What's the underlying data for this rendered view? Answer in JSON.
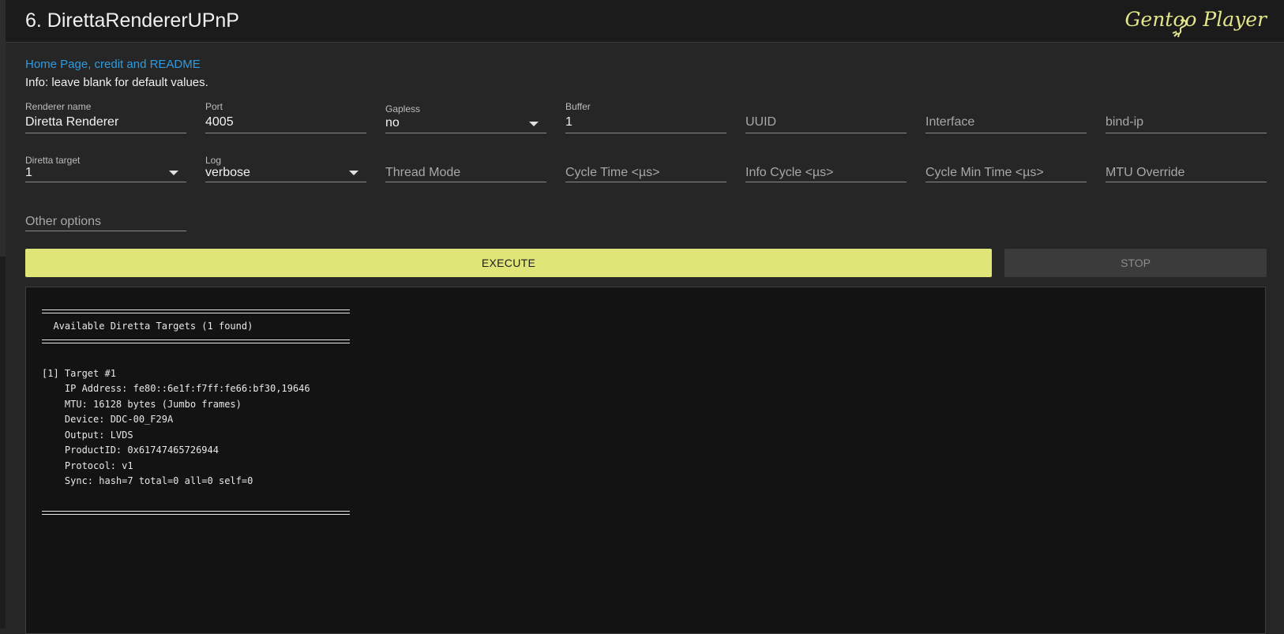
{
  "header": {
    "title": "6. DirettaRendererUPnP",
    "logo_text": "Gentoo Player"
  },
  "intro": {
    "link_text": "Home Page, credit and README",
    "info_text": "Info: leave blank for default values."
  },
  "fields": {
    "renderer_name": {
      "label": "Renderer name",
      "value": "Diretta Renderer"
    },
    "port": {
      "label": "Port",
      "value": "4005"
    },
    "gapless": {
      "label": "Gapless",
      "value": "no"
    },
    "buffer": {
      "label": "Buffer",
      "value": "1"
    },
    "uuid": {
      "placeholder": "UUID"
    },
    "interface": {
      "placeholder": "Interface"
    },
    "bind_ip": {
      "placeholder": "bind-ip"
    },
    "diretta_target": {
      "label": "Diretta target",
      "value": "1"
    },
    "log": {
      "label": "Log",
      "value": "verbose"
    },
    "thread_mode": {
      "placeholder": "Thread Mode"
    },
    "cycle_time": {
      "placeholder": "Cycle Time <µs>"
    },
    "info_cycle": {
      "placeholder": "Info Cycle <µs>"
    },
    "cycle_min_time": {
      "placeholder": "Cycle Min Time <µs>"
    },
    "mtu_override": {
      "placeholder": "MTU Override"
    },
    "other_options": {
      "placeholder": "Other options"
    }
  },
  "actions": {
    "execute_label": "EXECUTE",
    "stop_label": "STOP"
  },
  "console": {
    "heading": "  Available Diretta Targets (1 found)",
    "lines": [
      "[1] Target #1",
      "    IP Address: fe80::6e1f:f7ff:fe66:bf30,19646",
      "    MTU: 16128 bytes (Jumbo frames)",
      "    Device: DDC-00_F29A",
      "    Output: LVDS",
      "    ProductID: 0x61747465726944",
      "    Protocol: v1",
      "    Sync: hash=7 total=0 all=0 self=0"
    ]
  },
  "colors": {
    "accent": "#dfe677",
    "link": "#2e9be0",
    "background": "#262626",
    "console_bg": "#131313"
  }
}
